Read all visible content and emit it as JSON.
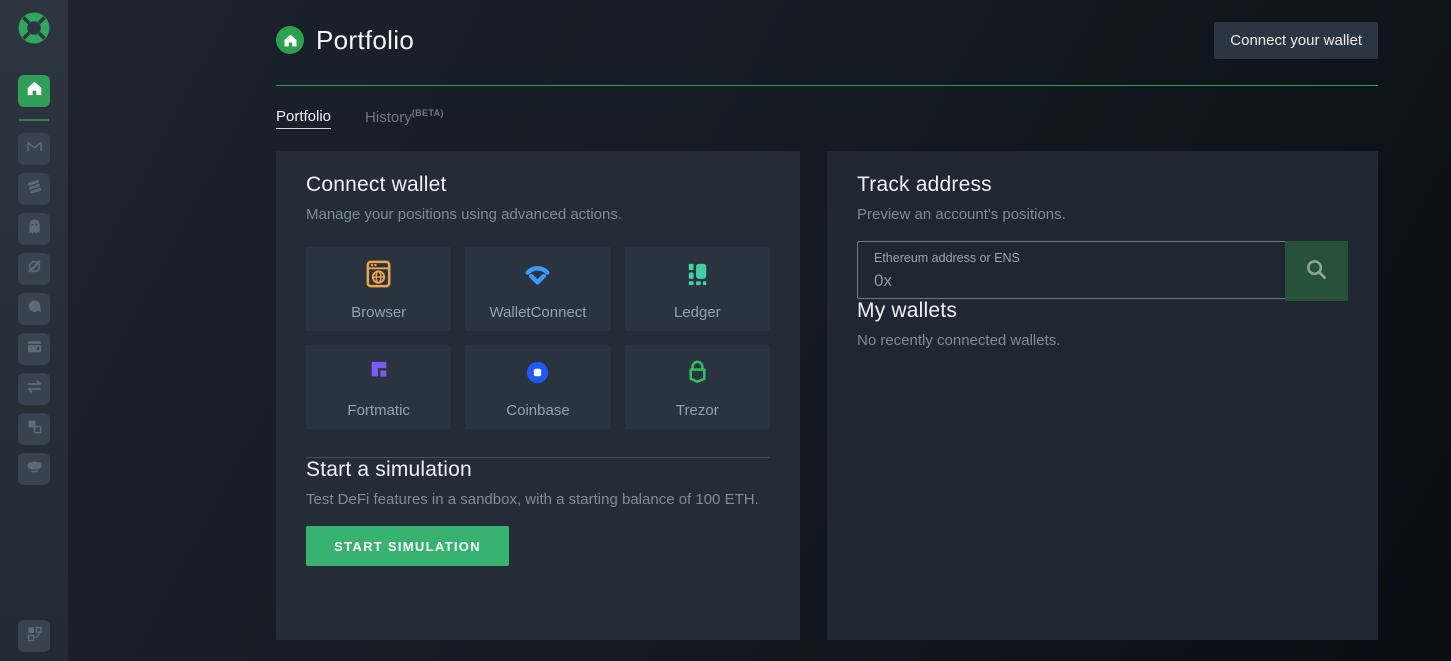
{
  "app": {
    "logo_icon": "defi-saver-logo",
    "accent_green": "#2fa65a"
  },
  "sidebar": {
    "icons": [
      "home",
      "maker",
      "compound",
      "aave",
      "reflexer",
      "liquity",
      "savings-wallet",
      "exchange",
      "shifter",
      "recipes",
      "connect"
    ],
    "active_item": "home",
    "active_color": "#2f9e58"
  },
  "header": {
    "title": "Portfolio",
    "title_icon": "home-icon",
    "connect_button": "Connect your wallet"
  },
  "tabs": {
    "portfolio": "Portfolio",
    "history": "History",
    "history_badge": "(BETA)",
    "active": "Portfolio"
  },
  "connect_wallet": {
    "title": "Connect wallet",
    "subtitle": "Manage your positions using advanced actions.",
    "options": [
      {
        "label": "Browser",
        "icon": "browser-wallet-icon",
        "color": "#f0a348"
      },
      {
        "label": "WalletConnect",
        "icon": "walletconnect-icon",
        "color": "#3b99fc"
      },
      {
        "label": "Ledger",
        "icon": "ledger-icon",
        "color": "#43cfa6"
      },
      {
        "label": "Fortmatic",
        "icon": "fortmatic-icon",
        "color": "#7a5cf5"
      },
      {
        "label": "Coinbase",
        "icon": "coinbase-icon",
        "color": "#2157f2"
      },
      {
        "label": "Trezor",
        "icon": "trezor-icon",
        "color": "#2fc05c"
      }
    ]
  },
  "simulation": {
    "title": "Start a simulation",
    "subtitle": "Test DeFi features in a sandbox, with a starting balance of 100 ETH.",
    "button": "START SIMULATION",
    "button_color": "#38b271"
  },
  "track_address": {
    "title": "Track address",
    "subtitle": "Preview an account's positions.",
    "input_label": "Ethereum address or ENS",
    "input_placeholder": "0x",
    "search_button_color": "#27523a"
  },
  "my_wallets": {
    "title": "My wallets",
    "empty": "No recently connected wallets."
  }
}
